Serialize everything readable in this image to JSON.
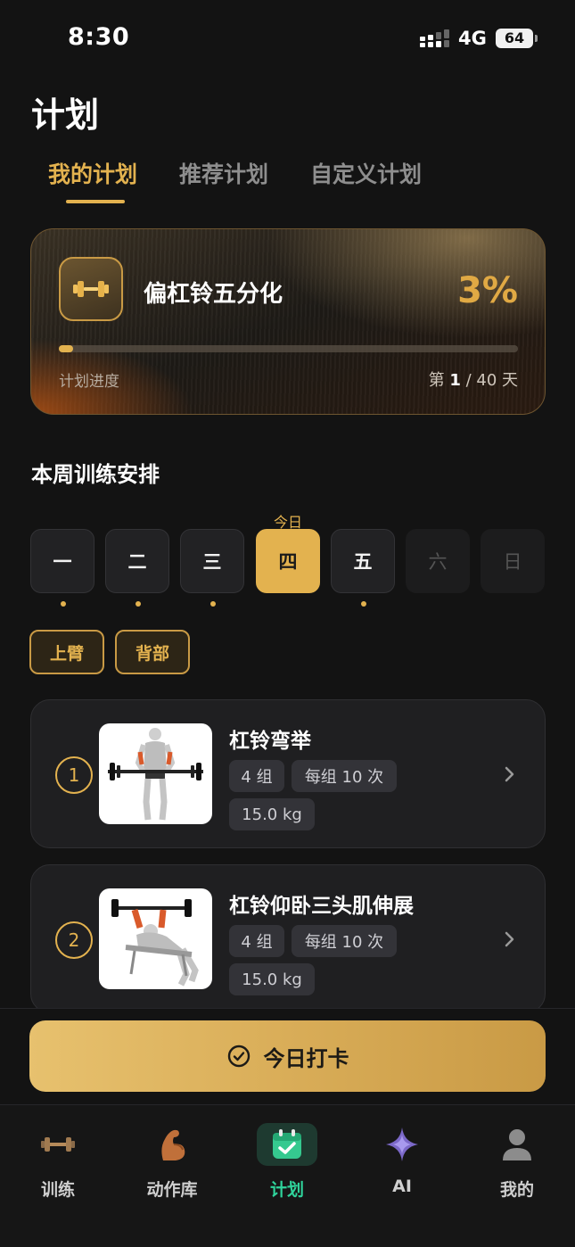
{
  "status": {
    "time": "8:30",
    "network": "4G",
    "battery": "64"
  },
  "page_title": "计划",
  "tabs": [
    {
      "label": "我的计划",
      "active": true
    },
    {
      "label": "推荐计划",
      "active": false
    },
    {
      "label": "自定义计划",
      "active": false
    }
  ],
  "plan": {
    "name": "偏杠铃五分化",
    "percent_text": "3%",
    "progress": 0.03,
    "progress_label": "计划进度",
    "days_prefix": "第 ",
    "current_day": "1",
    "days_suffix": " / 40 天",
    "icon": "dumbbell-icon"
  },
  "week": {
    "title": "本周训练安排",
    "today_label": "今日",
    "days": [
      {
        "label": "一",
        "state": "train"
      },
      {
        "label": "二",
        "state": "train"
      },
      {
        "label": "三",
        "state": "train"
      },
      {
        "label": "四",
        "state": "today"
      },
      {
        "label": "五",
        "state": "train"
      },
      {
        "label": "六",
        "state": "rest"
      },
      {
        "label": "日",
        "state": "rest"
      }
    ]
  },
  "muscle_tags": [
    "上臂",
    "背部"
  ],
  "exercises": [
    {
      "index": "1",
      "name": "杠铃弯举",
      "sets": "4 组",
      "reps": "每组 10 次",
      "weight": "15.0 kg",
      "image": "barbell-curl-figure"
    },
    {
      "index": "2",
      "name": "杠铃仰卧三头肌伸展",
      "sets": "4 组",
      "reps": "每组 10 次",
      "weight": "15.0 kg",
      "image": "lying-triceps-extension-figure"
    }
  ],
  "checkin": {
    "label": "今日打卡",
    "icon": "check-circle-icon"
  },
  "tabbar": [
    {
      "label": "训练",
      "icon": "dumbbell-icon",
      "active": false
    },
    {
      "label": "动作库",
      "icon": "bicep-icon",
      "active": false
    },
    {
      "label": "计划",
      "icon": "calendar-check-icon",
      "active": true
    },
    {
      "label": "AI",
      "icon": "sparkle-icon",
      "active": false
    },
    {
      "label": "我的",
      "icon": "person-icon",
      "active": false
    }
  ],
  "colors": {
    "accent": "#e3b24f",
    "active_tab": "#2fd39b",
    "background": "#131313"
  }
}
